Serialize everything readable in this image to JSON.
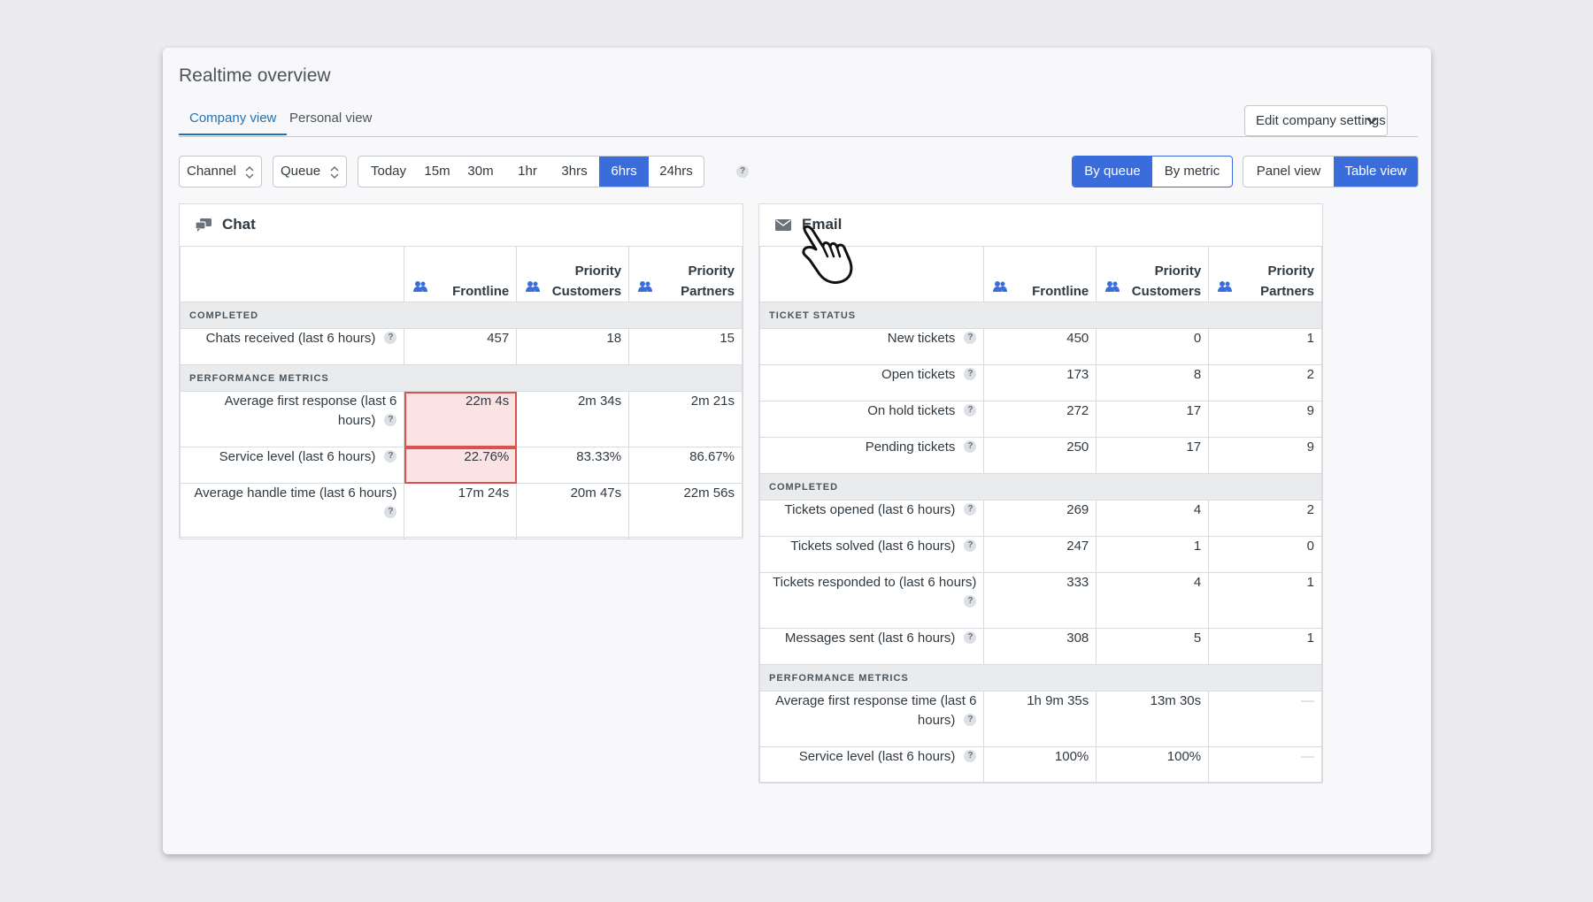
{
  "page": {
    "title": "Realtime overview"
  },
  "tabs": [
    {
      "label": "Company view",
      "active": true
    },
    {
      "label": "Personal view",
      "active": false
    }
  ],
  "edit_button": "Edit company settings",
  "filters": {
    "channel": "Channel",
    "queue": "Queue"
  },
  "time_ranges": [
    {
      "label": "Today",
      "active": false
    },
    {
      "label": "15m",
      "active": false
    },
    {
      "label": "30m",
      "active": false
    },
    {
      "label": "1hr",
      "active": false
    },
    {
      "label": "3hrs",
      "active": false
    },
    {
      "label": "6hrs",
      "active": true
    },
    {
      "label": "24hrs",
      "active": false
    }
  ],
  "help_glyph": "?",
  "grouping": [
    {
      "label": "By queue",
      "active": true
    },
    {
      "label": "By metric",
      "active": false
    }
  ],
  "view_mode": [
    {
      "label": "Panel view",
      "active": false
    },
    {
      "label": "Table view",
      "active": true
    }
  ],
  "accent_color": "#3a6ddb",
  "chat": {
    "title": "Chat",
    "icon": "chat-bubbles-icon",
    "columns": [
      [
        "Frontline"
      ],
      [
        "Priority",
        "Customers"
      ],
      [
        "Priority",
        "Partners"
      ]
    ],
    "sections": [
      {
        "title": "COMPLETED",
        "rows": [
          {
            "label": "Chats received (last 6 hours)",
            "values": [
              "457",
              "18",
              "15"
            ]
          }
        ]
      },
      {
        "title": "PERFORMANCE METRICS",
        "rows": [
          {
            "label": "Average first response (last 6 hours)",
            "values": [
              "22m 4s",
              "2m 34s",
              "2m 21s"
            ],
            "highlight": [
              0
            ]
          },
          {
            "label": "Service level (last 6 hours)",
            "values": [
              "22.76%",
              "83.33%",
              "86.67%"
            ],
            "highlight": [
              0
            ]
          },
          {
            "label": "Average handle time (last 6 hours)",
            "values": [
              "17m 24s",
              "20m 47s",
              "22m 56s"
            ]
          }
        ]
      }
    ]
  },
  "email": {
    "title": "Email",
    "icon": "envelope-icon",
    "columns": [
      [
        "Frontline"
      ],
      [
        "Priority",
        "Customers"
      ],
      [
        "Priority",
        "Partners"
      ]
    ],
    "sections": [
      {
        "title": "TICKET STATUS",
        "rows": [
          {
            "label": "New tickets",
            "values": [
              "450",
              "0",
              "1"
            ]
          },
          {
            "label": "Open tickets",
            "values": [
              "173",
              "8",
              "2"
            ]
          },
          {
            "label": "On hold tickets",
            "values": [
              "272",
              "17",
              "9"
            ]
          },
          {
            "label": "Pending tickets",
            "values": [
              "250",
              "17",
              "9"
            ]
          }
        ]
      },
      {
        "title": "COMPLETED",
        "rows": [
          {
            "label": "Tickets opened (last 6 hours)",
            "values": [
              "269",
              "4",
              "2"
            ]
          },
          {
            "label": "Tickets solved (last 6 hours)",
            "values": [
              "247",
              "1",
              "0"
            ]
          },
          {
            "label": "Tickets responded to (last 6 hours)",
            "values": [
              "333",
              "4",
              "1"
            ]
          },
          {
            "label": "Messages sent (last 6 hours)",
            "values": [
              "308",
              "5",
              "1"
            ]
          }
        ]
      },
      {
        "title": "PERFORMANCE METRICS",
        "rows": [
          {
            "label": "Average first response time (last 6 hours)",
            "values": [
              "1h 9m 35s",
              "13m 30s",
              "—"
            ]
          },
          {
            "label": "Service level (last 6 hours)",
            "values": [
              "100%",
              "100%",
              "—"
            ]
          }
        ]
      }
    ]
  }
}
